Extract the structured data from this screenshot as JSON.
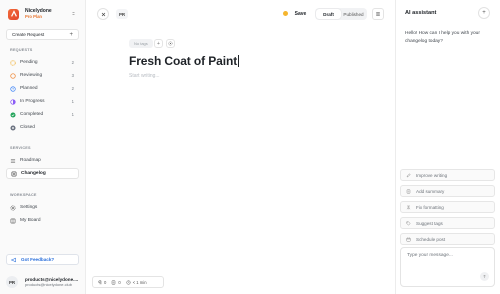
{
  "workspace": {
    "name": "Nicelydone",
    "plan": "Pro Plan"
  },
  "sidebar": {
    "create_label": "Create Request",
    "requests_label": "REQUESTS",
    "requests": [
      {
        "label": "Pending",
        "count": "2",
        "icon": "pending-circle-icon",
        "color": "#f2b134"
      },
      {
        "label": "Reviewing",
        "count": "3",
        "icon": "reviewing-circle-icon",
        "color": "#ef8a3a"
      },
      {
        "label": "Planned",
        "count": "2",
        "icon": "planned-clock-icon",
        "color": "#3b82f6"
      },
      {
        "label": "In Progress",
        "count": "1",
        "icon": "in-progress-icon",
        "color": "#8b5cf6"
      },
      {
        "label": "Completed",
        "count": "1",
        "icon": "completed-check-icon",
        "color": "#22a35a"
      },
      {
        "label": "Closed",
        "count": "",
        "icon": "closed-x-icon",
        "color": "#6b7280"
      }
    ],
    "services_label": "SERVICES",
    "services": [
      {
        "label": "Roadmap",
        "icon": "roadmap-icon"
      },
      {
        "label": "Changelog",
        "icon": "changelog-icon",
        "active": true
      }
    ],
    "workspace_label": "WORKSPACE",
    "workspace_items": [
      {
        "label": "Settings",
        "icon": "gear-icon"
      },
      {
        "label": "My Board",
        "icon": "board-icon"
      }
    ],
    "feedback_label": "Got Feedback?"
  },
  "user": {
    "initials": "PR",
    "name": "products@nicelydone....",
    "email": "products@nicelydone.club"
  },
  "topbar": {
    "author_initials": "PR",
    "save_label": "Save",
    "draft_label": "Draft",
    "published_label": "Published"
  },
  "editor": {
    "tag_placeholder": "No tags",
    "title": "Fresh Coat of Paint",
    "body_placeholder": "Start writing..."
  },
  "stats": {
    "paragraphs": "0",
    "words": "0",
    "reading_time": "< 1 min"
  },
  "ai": {
    "title": "AI assistant",
    "greeting": "Hello! How can I help you with your changelog today?",
    "actions": [
      "Improve writing",
      "Add summary",
      "Fix formatting",
      "Suggest tags",
      "Schedule post"
    ],
    "input_placeholder": "Type your message..."
  }
}
